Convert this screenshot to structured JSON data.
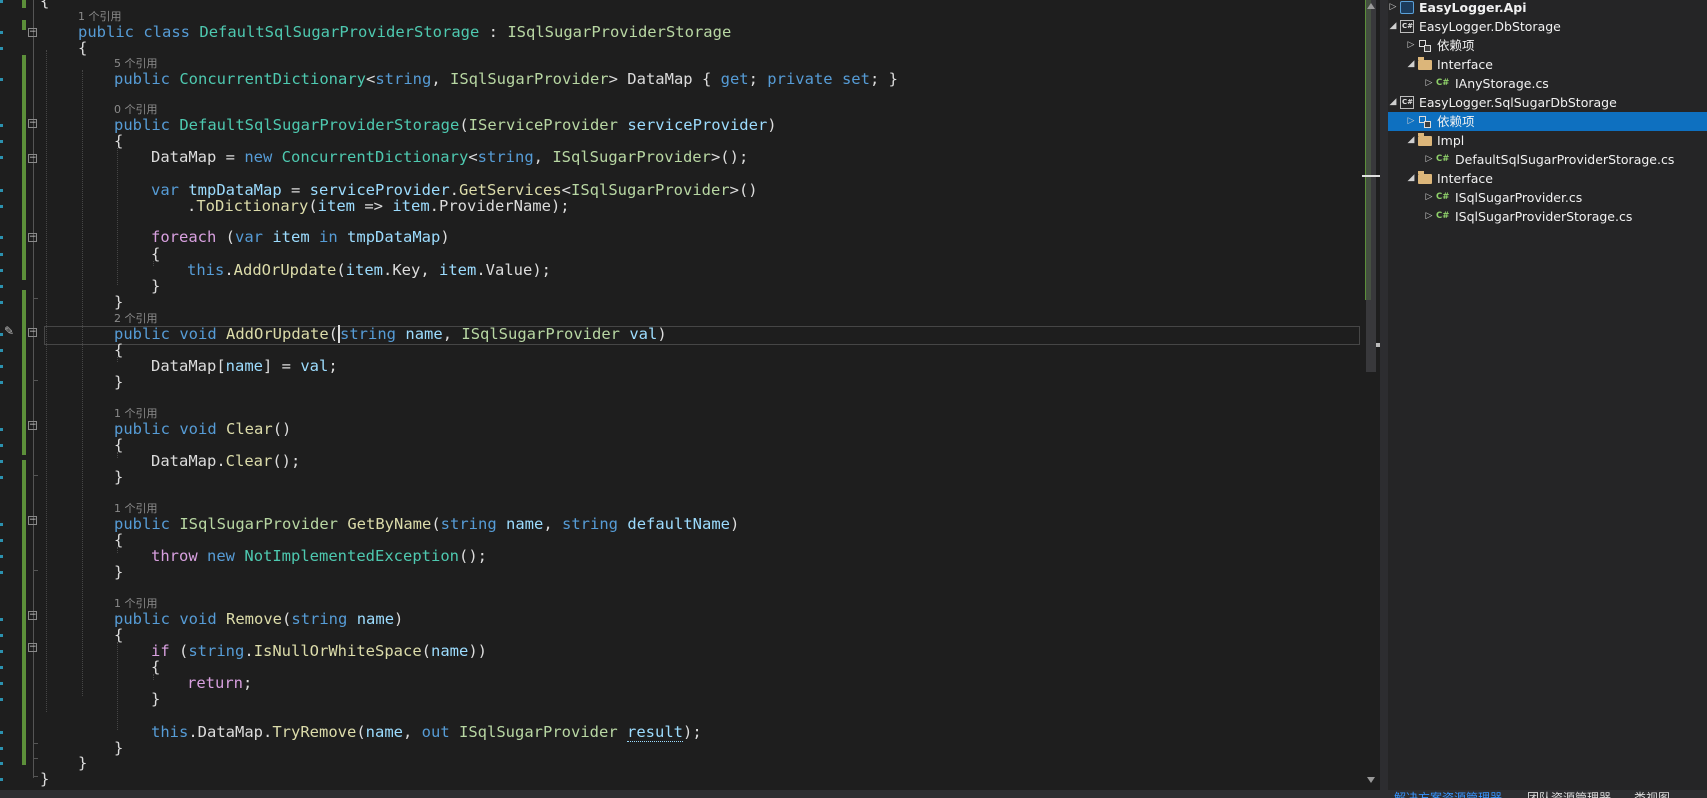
{
  "editor": {
    "lines": [
      {
        "tokens": [
          {
            "t": "{",
            "c": ""
          }
        ]
      },
      {
        "tokens": [
          {
            "t": "public",
            "c": "kw"
          },
          {
            "t": " ",
            "c": ""
          },
          {
            "t": "class",
            "c": "kw"
          },
          {
            "t": " ",
            "c": ""
          },
          {
            "t": "DefaultSqlSugarProviderStorage",
            "c": "typ"
          },
          {
            "t": " : ",
            "c": ""
          },
          {
            "t": "ISqlSugarProviderStorage",
            "c": "ifc"
          }
        ]
      },
      {
        "tokens": [
          {
            "t": "{",
            "c": ""
          }
        ]
      },
      {
        "tokens": [
          {
            "t": "public",
            "c": "kw"
          },
          {
            "t": " ",
            "c": ""
          },
          {
            "t": "ConcurrentDictionary",
            "c": "typ"
          },
          {
            "t": "<",
            "c": ""
          },
          {
            "t": "string",
            "c": "kw"
          },
          {
            "t": ", ",
            "c": ""
          },
          {
            "t": "ISqlSugarProvider",
            "c": "ifc"
          },
          {
            "t": "> DataMap { ",
            "c": ""
          },
          {
            "t": "get",
            "c": "kw"
          },
          {
            "t": "; ",
            "c": ""
          },
          {
            "t": "private",
            "c": "kw"
          },
          {
            "t": " ",
            "c": ""
          },
          {
            "t": "set",
            "c": "kw"
          },
          {
            "t": "; }",
            "c": ""
          }
        ]
      },
      {
        "tokens": [
          {
            "t": "public",
            "c": "kw"
          },
          {
            "t": " ",
            "c": ""
          },
          {
            "t": "DefaultSqlSugarProviderStorage",
            "c": "typ"
          },
          {
            "t": "(",
            "c": ""
          },
          {
            "t": "IServiceProvider",
            "c": "ifc"
          },
          {
            "t": " ",
            "c": ""
          },
          {
            "t": "serviceProvider",
            "c": "var"
          },
          {
            "t": ")",
            "c": ""
          }
        ]
      },
      {
        "tokens": [
          {
            "t": "{",
            "c": ""
          }
        ]
      },
      {
        "tokens": [
          {
            "t": "DataMap = ",
            "c": ""
          },
          {
            "t": "new",
            "c": "kw"
          },
          {
            "t": " ",
            "c": ""
          },
          {
            "t": "ConcurrentDictionary",
            "c": "typ"
          },
          {
            "t": "<",
            "c": ""
          },
          {
            "t": "string",
            "c": "kw"
          },
          {
            "t": ", ",
            "c": ""
          },
          {
            "t": "ISqlSugarProvider",
            "c": "ifc"
          },
          {
            "t": ">();",
            "c": ""
          }
        ]
      },
      {
        "tokens": [
          {
            "t": "var",
            "c": "kw"
          },
          {
            "t": " ",
            "c": ""
          },
          {
            "t": "tmpDataMap",
            "c": "var"
          },
          {
            "t": " = ",
            "c": ""
          },
          {
            "t": "serviceProvider",
            "c": "var"
          },
          {
            "t": ".",
            "c": ""
          },
          {
            "t": "GetServices",
            "c": "mth"
          },
          {
            "t": "<",
            "c": ""
          },
          {
            "t": "ISqlSugarProvider",
            "c": "ifc"
          },
          {
            "t": ">()",
            "c": ""
          }
        ]
      },
      {
        "tokens": [
          {
            "t": ".",
            "c": ""
          },
          {
            "t": "ToDictionary",
            "c": "mth"
          },
          {
            "t": "(",
            "c": ""
          },
          {
            "t": "item",
            "c": "var"
          },
          {
            "t": " => ",
            "c": ""
          },
          {
            "t": "item",
            "c": "var"
          },
          {
            "t": ".ProviderName);",
            "c": ""
          }
        ]
      },
      {
        "tokens": [
          {
            "t": "foreach",
            "c": "ctl"
          },
          {
            "t": " (",
            "c": ""
          },
          {
            "t": "var",
            "c": "kw"
          },
          {
            "t": " ",
            "c": ""
          },
          {
            "t": "item",
            "c": "var"
          },
          {
            "t": " ",
            "c": ""
          },
          {
            "t": "in",
            "c": "kw"
          },
          {
            "t": " ",
            "c": ""
          },
          {
            "t": "tmpDataMap",
            "c": "var"
          },
          {
            "t": ")",
            "c": ""
          }
        ]
      },
      {
        "tokens": [
          {
            "t": "{",
            "c": ""
          }
        ]
      },
      {
        "tokens": [
          {
            "t": "this",
            "c": "kw"
          },
          {
            "t": ".",
            "c": ""
          },
          {
            "t": "AddOrUpdate",
            "c": "mth"
          },
          {
            "t": "(",
            "c": ""
          },
          {
            "t": "item",
            "c": "var"
          },
          {
            "t": ".Key, ",
            "c": ""
          },
          {
            "t": "item",
            "c": "var"
          },
          {
            "t": ".Value);",
            "c": ""
          }
        ]
      },
      {
        "tokens": [
          {
            "t": "}",
            "c": ""
          }
        ]
      },
      {
        "tokens": [
          {
            "t": "}",
            "c": ""
          }
        ]
      },
      {
        "tokens": [
          {
            "t": "public",
            "c": "kw"
          },
          {
            "t": " ",
            "c": ""
          },
          {
            "t": "void",
            "c": "kw"
          },
          {
            "t": " ",
            "c": ""
          },
          {
            "t": "AddOrUpdate",
            "c": "mth"
          },
          {
            "t": "(",
            "c": "cur"
          },
          {
            "t": "string",
            "c": "kw"
          },
          {
            "t": " ",
            "c": ""
          },
          {
            "t": "name",
            "c": "var"
          },
          {
            "t": ", ",
            "c": ""
          },
          {
            "t": "ISqlSugarProvider",
            "c": "ifc"
          },
          {
            "t": " ",
            "c": ""
          },
          {
            "t": "val",
            "c": "var"
          },
          {
            "t": ")",
            "c": ""
          }
        ]
      },
      {
        "tokens": [
          {
            "t": "{",
            "c": ""
          }
        ]
      },
      {
        "tokens": [
          {
            "t": "DataMap[",
            "c": ""
          },
          {
            "t": "name",
            "c": "var"
          },
          {
            "t": "] = ",
            "c": ""
          },
          {
            "t": "val",
            "c": "var"
          },
          {
            "t": ";",
            "c": ""
          }
        ]
      },
      {
        "tokens": [
          {
            "t": "}",
            "c": ""
          }
        ]
      },
      {
        "tokens": [
          {
            "t": "public",
            "c": "kw"
          },
          {
            "t": " ",
            "c": ""
          },
          {
            "t": "void",
            "c": "kw"
          },
          {
            "t": " ",
            "c": ""
          },
          {
            "t": "Clear",
            "c": "mth"
          },
          {
            "t": "()",
            "c": ""
          }
        ]
      },
      {
        "tokens": [
          {
            "t": "{",
            "c": ""
          }
        ]
      },
      {
        "tokens": [
          {
            "t": "DataMap.",
            "c": ""
          },
          {
            "t": "Clear",
            "c": "mth"
          },
          {
            "t": "();",
            "c": ""
          }
        ]
      },
      {
        "tokens": [
          {
            "t": "}",
            "c": ""
          }
        ]
      },
      {
        "tokens": [
          {
            "t": "public",
            "c": "kw"
          },
          {
            "t": " ",
            "c": ""
          },
          {
            "t": "ISqlSugarProvider",
            "c": "ifc"
          },
          {
            "t": " ",
            "c": ""
          },
          {
            "t": "GetByName",
            "c": "mth"
          },
          {
            "t": "(",
            "c": ""
          },
          {
            "t": "string",
            "c": "kw"
          },
          {
            "t": " ",
            "c": ""
          },
          {
            "t": "name",
            "c": "var"
          },
          {
            "t": ", ",
            "c": ""
          },
          {
            "t": "string",
            "c": "kw"
          },
          {
            "t": " ",
            "c": ""
          },
          {
            "t": "defaultName",
            "c": "var"
          },
          {
            "t": ")",
            "c": ""
          }
        ]
      },
      {
        "tokens": [
          {
            "t": "{",
            "c": ""
          }
        ]
      },
      {
        "tokens": [
          {
            "t": "throw",
            "c": "ctl"
          },
          {
            "t": " ",
            "c": ""
          },
          {
            "t": "new",
            "c": "kw"
          },
          {
            "t": " ",
            "c": ""
          },
          {
            "t": "NotImplementedException",
            "c": "typ"
          },
          {
            "t": "();",
            "c": ""
          }
        ]
      },
      {
        "tokens": [
          {
            "t": "}",
            "c": ""
          }
        ]
      },
      {
        "tokens": [
          {
            "t": "public",
            "c": "kw"
          },
          {
            "t": " ",
            "c": ""
          },
          {
            "t": "void",
            "c": "kw"
          },
          {
            "t": " ",
            "c": ""
          },
          {
            "t": "Remove",
            "c": "mth"
          },
          {
            "t": "(",
            "c": ""
          },
          {
            "t": "string",
            "c": "kw"
          },
          {
            "t": " ",
            "c": ""
          },
          {
            "t": "name",
            "c": "var"
          },
          {
            "t": ")",
            "c": ""
          }
        ]
      },
      {
        "tokens": [
          {
            "t": "{",
            "c": ""
          }
        ]
      },
      {
        "tokens": [
          {
            "t": "if",
            "c": "ctl"
          },
          {
            "t": " (",
            "c": ""
          },
          {
            "t": "string",
            "c": "kw"
          },
          {
            "t": ".",
            "c": ""
          },
          {
            "t": "IsNullOrWhiteSpace",
            "c": "mth"
          },
          {
            "t": "(",
            "c": ""
          },
          {
            "t": "name",
            "c": "var"
          },
          {
            "t": "))",
            "c": ""
          }
        ]
      },
      {
        "tokens": [
          {
            "t": "{",
            "c": ""
          }
        ]
      },
      {
        "tokens": [
          {
            "t": "return",
            "c": "ctl"
          },
          {
            "t": ";",
            "c": ""
          }
        ]
      },
      {
        "tokens": [
          {
            "t": "}",
            "c": ""
          }
        ]
      },
      {
        "tokens": [
          {
            "t": "this",
            "c": "kw"
          },
          {
            "t": ".DataMap.",
            "c": ""
          },
          {
            "t": "TryRemove",
            "c": "mth"
          },
          {
            "t": "(",
            "c": ""
          },
          {
            "t": "name",
            "c": "var"
          },
          {
            "t": ", ",
            "c": ""
          },
          {
            "t": "out",
            "c": "kw"
          },
          {
            "t": " ",
            "c": ""
          },
          {
            "t": "ISqlSugarProvider",
            "c": "ifc"
          },
          {
            "t": " ",
            "c": ""
          },
          {
            "t": "result",
            "c": "var sq"
          },
          {
            "t": ");",
            "c": ""
          }
        ]
      },
      {
        "tokens": [
          {
            "t": "}",
            "c": ""
          }
        ]
      },
      {
        "tokens": [
          {
            "t": "}",
            "c": ""
          }
        ]
      },
      {
        "tokens": [
          {
            "t": "}",
            "c": ""
          }
        ]
      }
    ],
    "lens": [
      {
        "text": "1 个引用"
      },
      {
        "text": "5 个引用"
      },
      {
        "text": "0 个引用"
      },
      {
        "text": "2 个引用"
      },
      {
        "text": "1 个引用"
      },
      {
        "text": "1 个引用"
      },
      {
        "text": "1 个引用"
      }
    ]
  },
  "solution_explorer": {
    "nodes": [
      {
        "label": "EasyLogger.Api",
        "icon": "web-project-icon",
        "expanded": false,
        "bold": true,
        "selected": false
      },
      {
        "label": "EasyLogger.DbStorage",
        "icon": "csharp-project-icon",
        "expanded": true,
        "bold": false,
        "selected": false
      },
      {
        "label": "依赖项",
        "icon": "dependencies-icon",
        "expanded": false,
        "bold": false,
        "selected": false
      },
      {
        "label": "Interface",
        "icon": "folder-icon",
        "expanded": true,
        "bold": false,
        "selected": false
      },
      {
        "label": "IAnyStorage.cs",
        "icon": "csharp-file-icon",
        "expanded": false,
        "bold": false,
        "selected": false
      },
      {
        "label": "EasyLogger.SqlSugarDbStorage",
        "icon": "csharp-project-icon",
        "expanded": true,
        "bold": false,
        "selected": false
      },
      {
        "label": "依赖项",
        "icon": "dependencies-icon",
        "expanded": false,
        "bold": false,
        "selected": true
      },
      {
        "label": "Impl",
        "icon": "folder-icon",
        "expanded": true,
        "bold": false,
        "selected": false
      },
      {
        "label": "DefaultSqlSugarProviderStorage.cs",
        "icon": "csharp-file-icon",
        "expanded": false,
        "bold": false,
        "selected": false
      },
      {
        "label": "Interface",
        "icon": "folder-icon",
        "expanded": true,
        "bold": false,
        "selected": false
      },
      {
        "label": "ISqlSugarProvider.cs",
        "icon": "csharp-file-icon",
        "expanded": false,
        "bold": false,
        "selected": false
      },
      {
        "label": "ISqlSugarProviderStorage.cs",
        "icon": "csharp-file-icon",
        "expanded": false,
        "bold": false,
        "selected": false
      }
    ]
  },
  "bottom": {
    "status_text": "",
    "tabs": [
      {
        "label": "解决方案资源管理器",
        "active": true
      },
      {
        "label": "团队资源管理器",
        "active": false
      },
      {
        "label": "类视图",
        "active": false
      }
    ]
  },
  "colors": {
    "editor_bg": "#1e1e1e",
    "keyword": "#569cd6",
    "type": "#4ec9b0",
    "interface": "#b8d7a3",
    "method": "#dcdcaa",
    "variable": "#9cdcfe",
    "control": "#d8a0df",
    "selection": "#0e70c0",
    "change_marker": "#5c8f3a"
  }
}
